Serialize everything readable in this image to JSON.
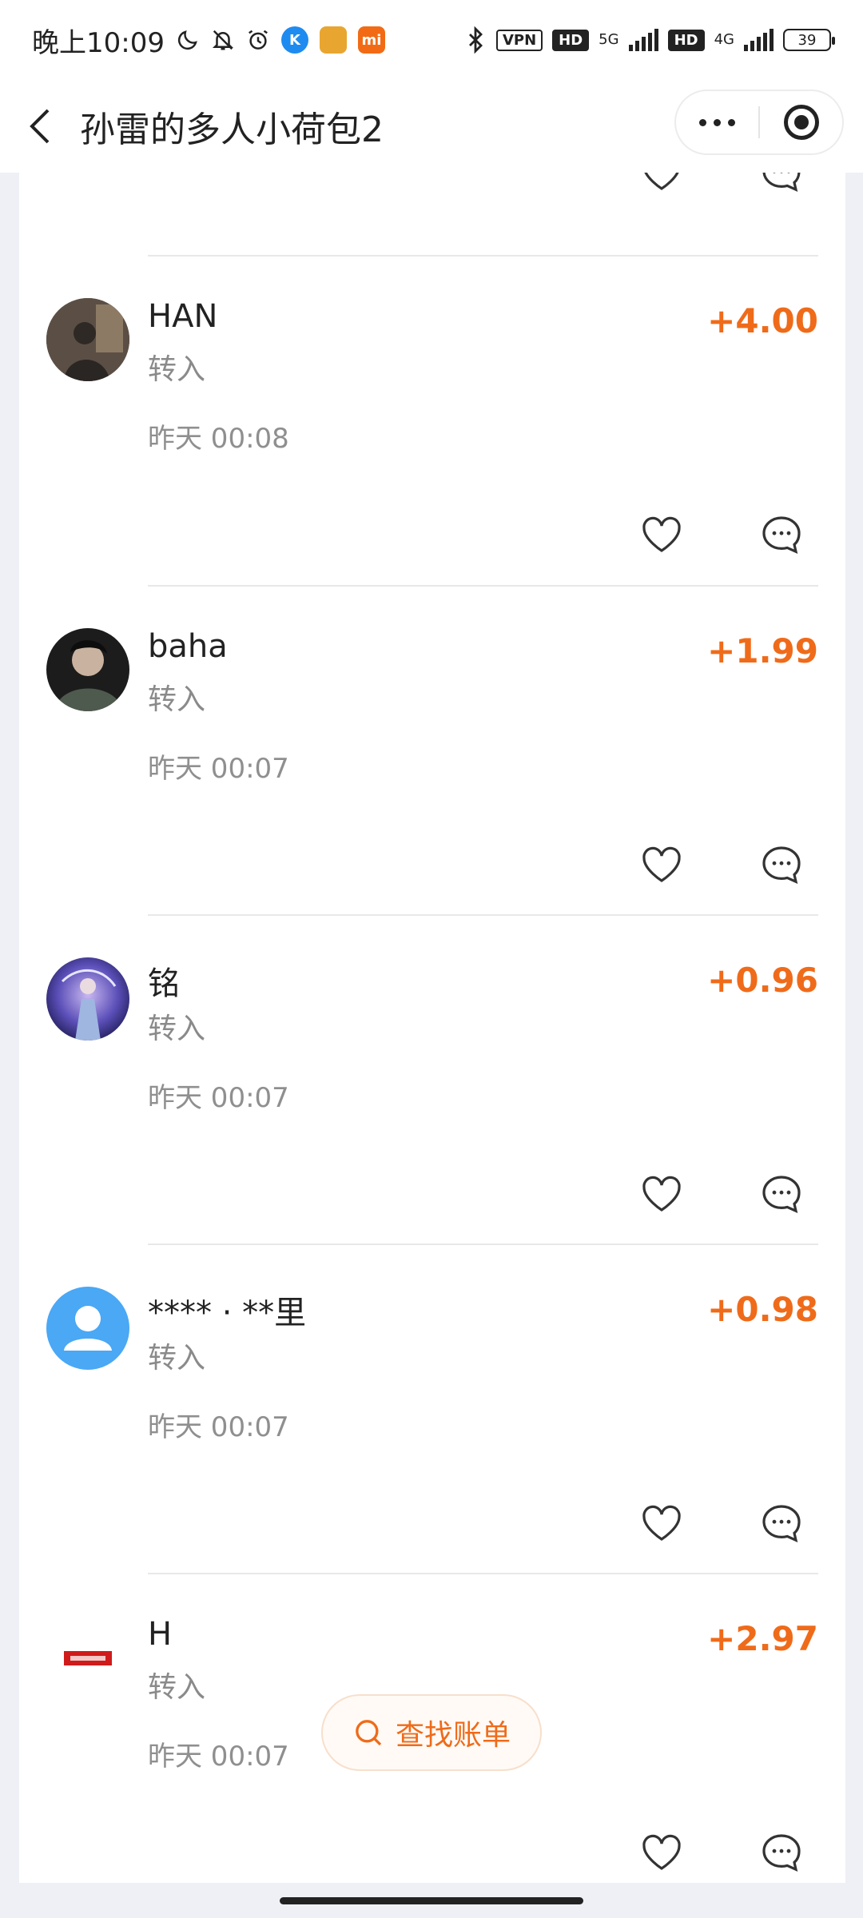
{
  "status_bar": {
    "time": "晚上10:09",
    "vpn": "VPN",
    "hd": "HD",
    "net1": "5G",
    "net2": "4G",
    "battery": "39",
    "mi": "mi"
  },
  "nav": {
    "title": "孙雷的多人小荷包2"
  },
  "entries": [
    {
      "name": "HAN",
      "type": "转入",
      "time": "昨天 00:08",
      "amount": "+4.00"
    },
    {
      "name": "baha",
      "type": "转入",
      "time": "昨天 00:07",
      "amount": "+1.99"
    },
    {
      "name": "铭",
      "type": "转入",
      "time": "昨天 00:07",
      "amount": "+0.96"
    },
    {
      "name": "**** · **里",
      "type": "转入",
      "time": "昨天 00:07",
      "amount": "+0.98"
    },
    {
      "name": "H",
      "type": "转入",
      "time": "昨天 00:07",
      "amount": "+2.97"
    }
  ],
  "search_button": {
    "label": "查找账单"
  },
  "colors": {
    "accent": "#ef6b1a",
    "background": "#eef0f5",
    "default_avatar": "#4aa8f5"
  },
  "icons": [
    "back-icon",
    "more-icon",
    "target-icon",
    "heart-icon",
    "comment-icon",
    "search-icon"
  ]
}
